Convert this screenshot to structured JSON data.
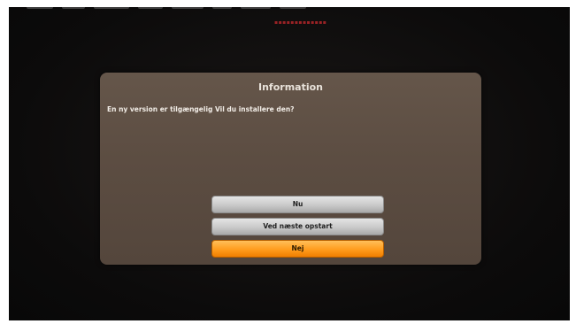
{
  "dialog": {
    "title": "Information",
    "message": "En ny version er tilgængelig Vil du installere den?",
    "buttons": [
      {
        "label": "Nu",
        "focused": false
      },
      {
        "label": "Ved næste opstart",
        "focused": false
      },
      {
        "label": "Nej",
        "focused": true
      }
    ]
  },
  "colors": {
    "background": "#0c0b0b",
    "dialog": "#5c4d42",
    "button": "#c9c9c9",
    "button_focus": "#ff9c1d"
  }
}
